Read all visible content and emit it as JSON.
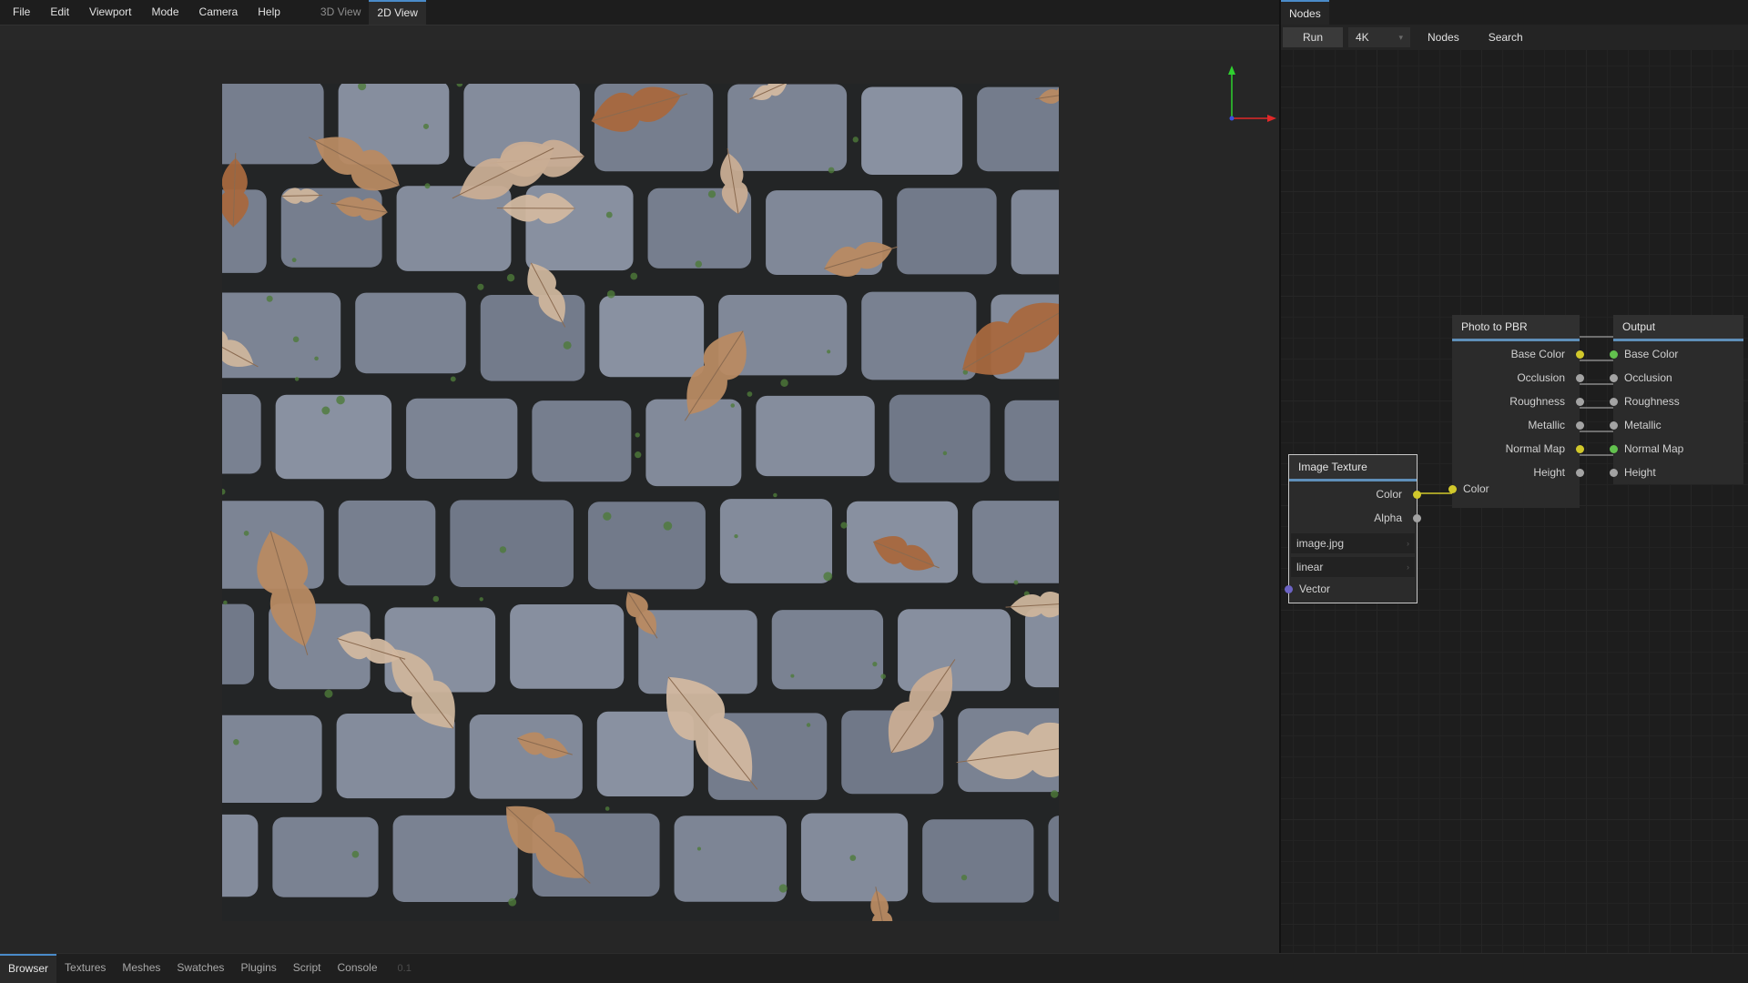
{
  "menu": {
    "items": [
      "File",
      "Edit",
      "Viewport",
      "Mode",
      "Camera",
      "Help"
    ],
    "view_tabs": [
      {
        "label": "3D View",
        "active": false
      },
      {
        "label": "2D View",
        "active": true
      }
    ]
  },
  "viewport": {
    "texture": "cobblestone pavement with fallen oak leaves",
    "gizmo_axes": [
      "y-green",
      "x-red",
      "z-blue"
    ]
  },
  "node_panel": {
    "tab": "Nodes",
    "toolbar": {
      "run_label": "Run",
      "resolution": "4K",
      "nodes_label": "Nodes",
      "search_label": "Search"
    },
    "nodes": {
      "image_texture": {
        "title": "Image Texture",
        "outputs": [
          "Color",
          "Alpha"
        ],
        "file": "image.jpg",
        "interpolation": "linear",
        "input": "Vector"
      },
      "photo_to_pbr": {
        "title": "Photo to PBR",
        "outputs": [
          "Base Color",
          "Occlusion",
          "Roughness",
          "Metallic",
          "Normal Map",
          "Height"
        ],
        "input": "Color"
      },
      "output": {
        "title": "Output",
        "inputs": [
          "Base Color",
          "Occlusion",
          "Roughness",
          "Metallic",
          "Normal Map",
          "Height"
        ]
      }
    }
  },
  "bottom_tabs": [
    {
      "label": "Browser",
      "active": true
    },
    {
      "label": "Textures",
      "active": false
    },
    {
      "label": "Meshes",
      "active": false
    },
    {
      "label": "Swatches",
      "active": false
    },
    {
      "label": "Plugins",
      "active": false
    },
    {
      "label": "Script",
      "active": false
    },
    {
      "label": "Console",
      "active": false
    }
  ],
  "version": "0.1",
  "colors": {
    "accent": "#4a8bc9",
    "socket_yellow": "#d1c82b",
    "socket_green": "#62c14e",
    "socket_gray": "#a3a3a3",
    "socket_purple": "#6c63c4",
    "stone": "#7b8494",
    "leaf": "#c9a98e"
  }
}
